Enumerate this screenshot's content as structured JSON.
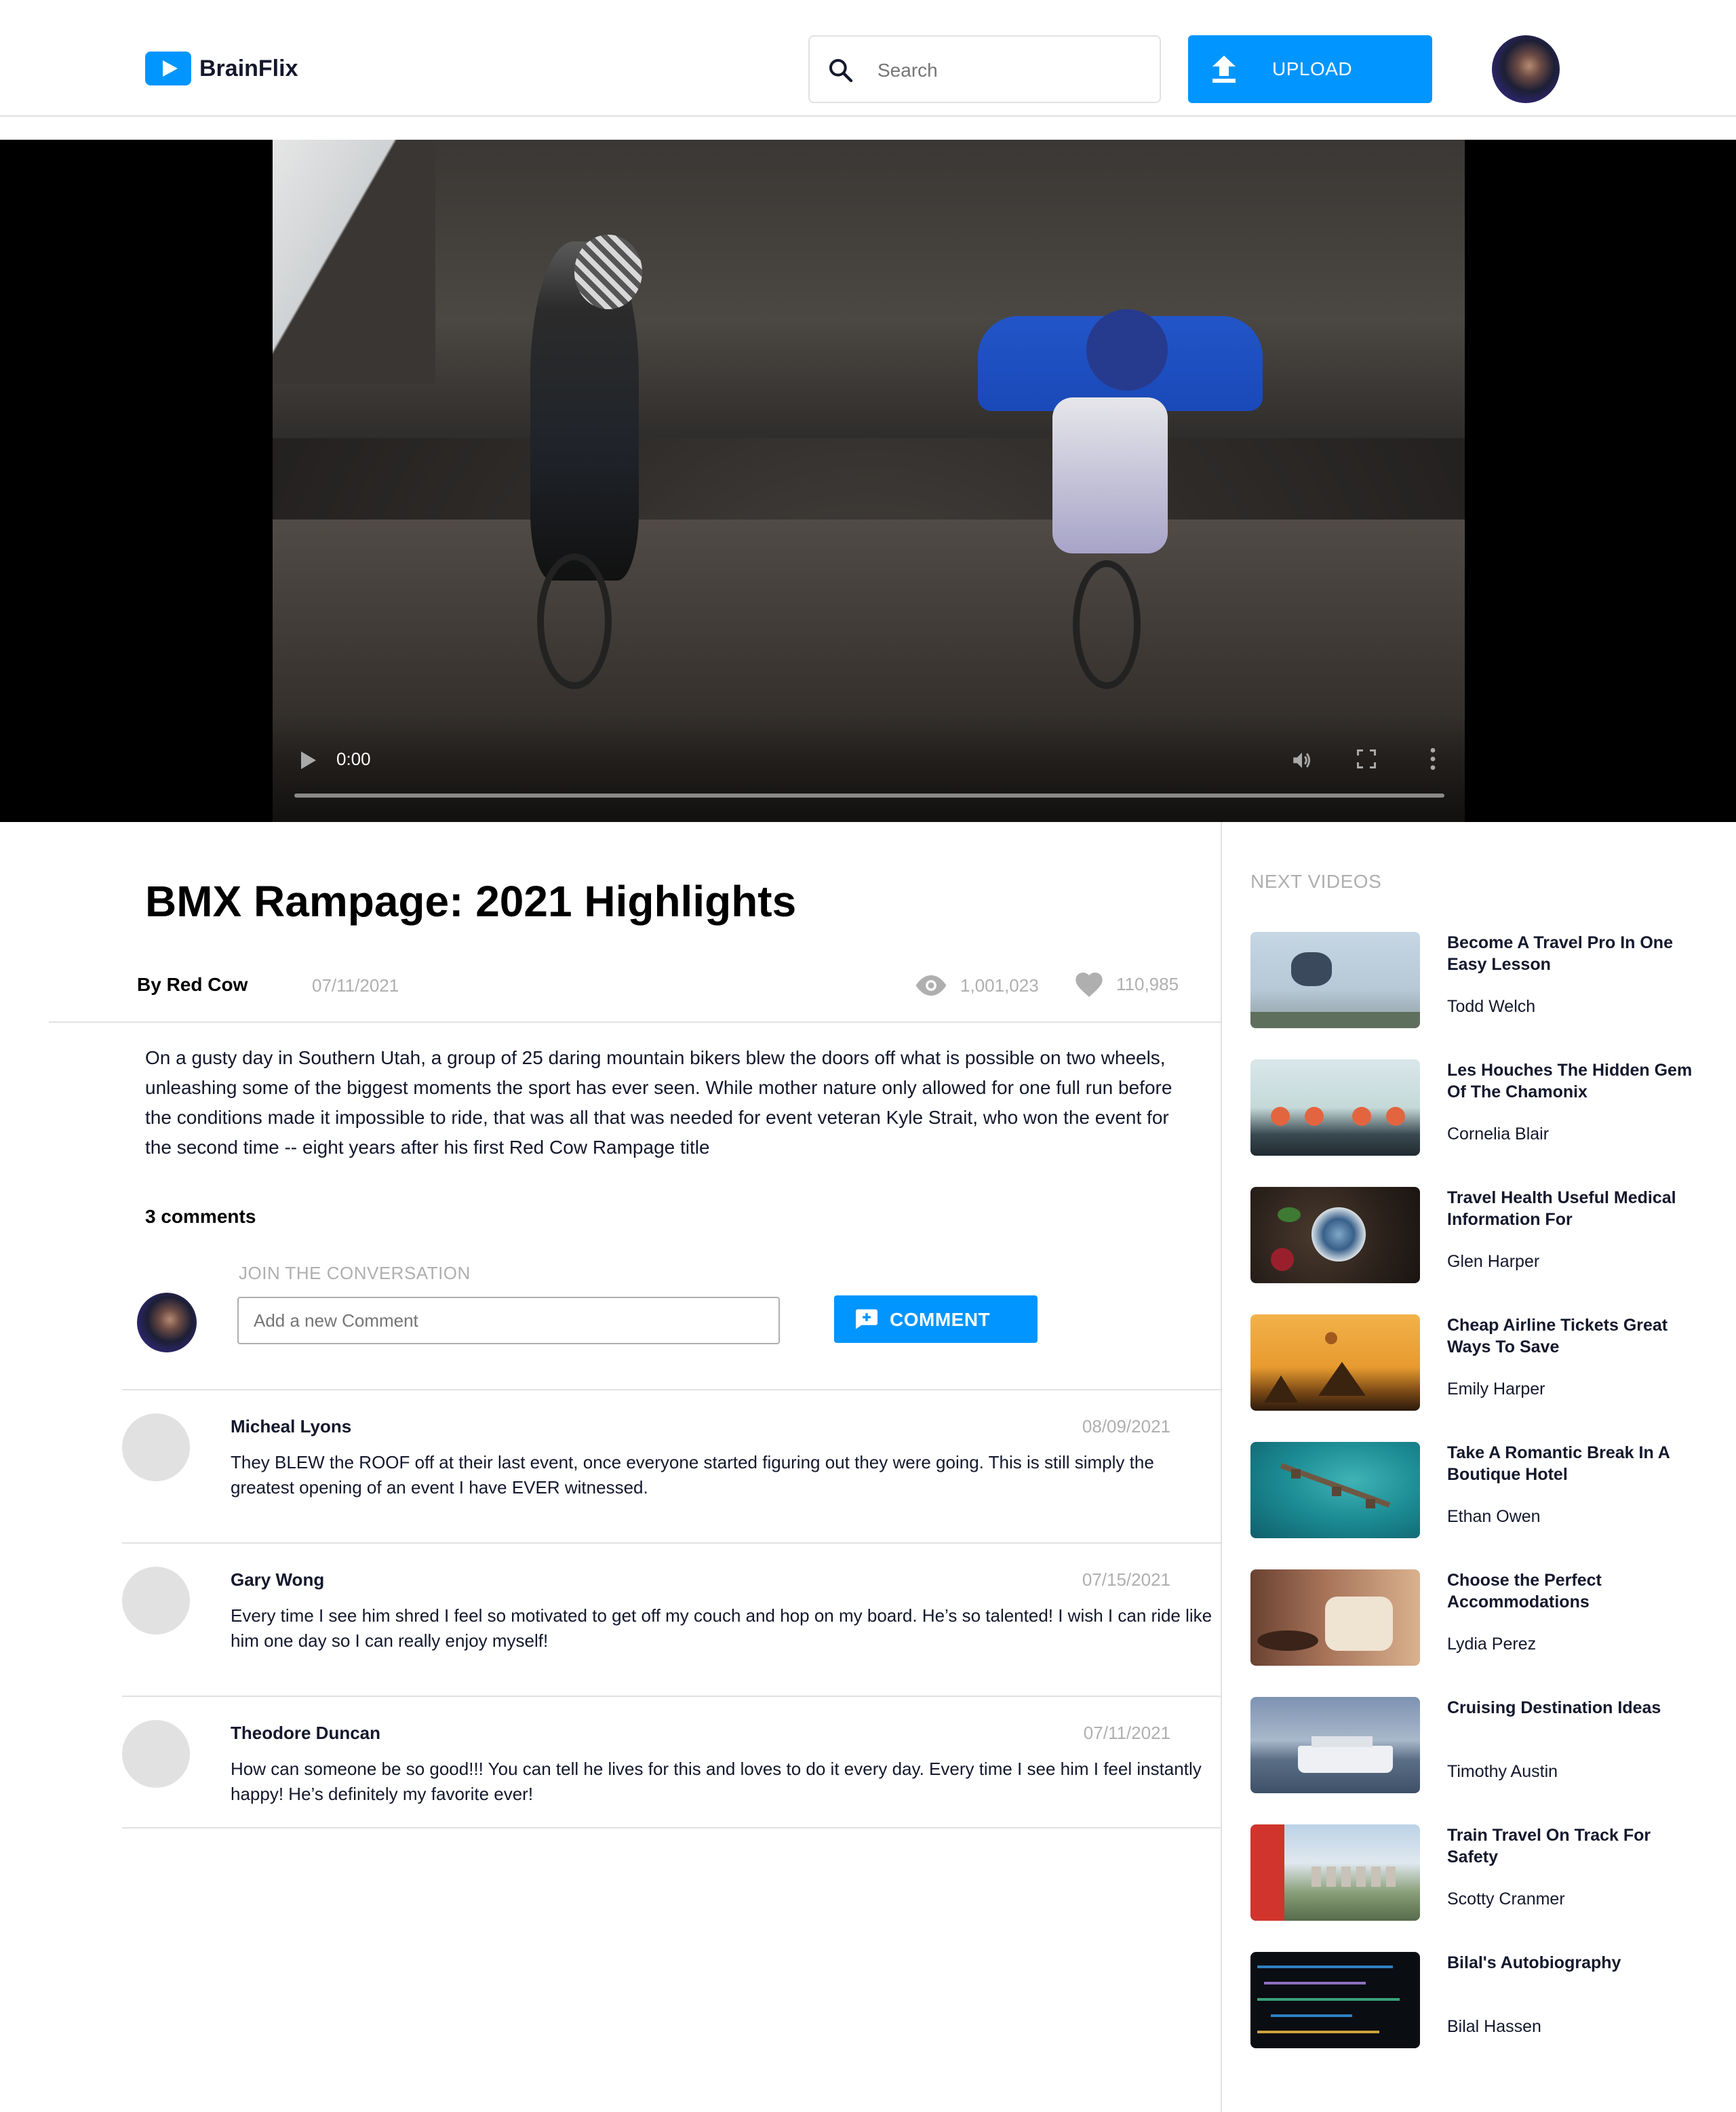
{
  "header": {
    "logo_text": "BrainFlix",
    "search_placeholder": "Search",
    "upload_label": "UPLOAD"
  },
  "video": {
    "time": "0:00",
    "progress": 0
  },
  "main": {
    "title": "BMX Rampage: 2021 Highlights",
    "channel": "By Red Cow",
    "date": "07/11/2021",
    "views": "1,001,023",
    "likes": "110,985",
    "description": "On a gusty day in Southern Utah, a group of 25 daring mountain bikers blew the doors off what is possible on two wheels, unleashing some of the biggest moments the sport has ever seen. While mother nature only allowed for one full run before the conditions made it impossible to ride, that was all that was needed for event veteran Kyle Strait, who won the event for the second time -- eight years after his first Red Cow Rampage title"
  },
  "comments": {
    "count_label": "3 comments",
    "join_label": "JOIN THE CONVERSATION",
    "input_placeholder": "Add a new Comment",
    "button_label": "COMMENT",
    "items": [
      {
        "name": "Micheal Lyons",
        "date": "08/09/2021",
        "text": "They BLEW the ROOF off at their last event, once everyone started figuring out they were going. This is still simply the greatest opening of an event I have EVER witnessed."
      },
      {
        "name": "Gary Wong",
        "date": "07/15/2021",
        "text": "Every time I see him shred I feel so motivated to get off my couch and hop on my board. He’s so talented! I wish I can ride like him one day so I can really enjoy myself!"
      },
      {
        "name": "Theodore Duncan",
        "date": "07/11/2021",
        "text": "How can someone be so good!!! You can tell he lives for this and loves to do it every day. Every time I see him I feel instantly happy! He’s definitely my favorite ever!"
      }
    ]
  },
  "sidebar": {
    "label": "NEXT VIDEOS",
    "items": [
      {
        "title": "Become A Travel Pro In One Easy Lesson",
        "channel": "Todd Welch"
      },
      {
        "title": "Les Houches The Hidden Gem Of The Chamonix",
        "channel": "Cornelia Blair"
      },
      {
        "title": "Travel Health Useful Medical Information For",
        "channel": "Glen Harper"
      },
      {
        "title": "Cheap Airline Tickets Great Ways To Save",
        "channel": "Emily Harper"
      },
      {
        "title": "Take A Romantic Break In A Boutique Hotel",
        "channel": "Ethan Owen"
      },
      {
        "title": "Choose the Perfect Accommodations",
        "channel": "Lydia Perez"
      },
      {
        "title": "Cruising Destination Ideas",
        "channel": "Timothy Austin"
      },
      {
        "title": "Train Travel On Track For Safety",
        "channel": "Scotty Cranmer"
      },
      {
        "title": "Bilal's Autobiography",
        "channel": "Bilal Hassen"
      }
    ]
  },
  "colors": {
    "accent": "#0095ff",
    "text": "#13182c",
    "muted": "#afafaf",
    "border": "#e1e1e1"
  }
}
